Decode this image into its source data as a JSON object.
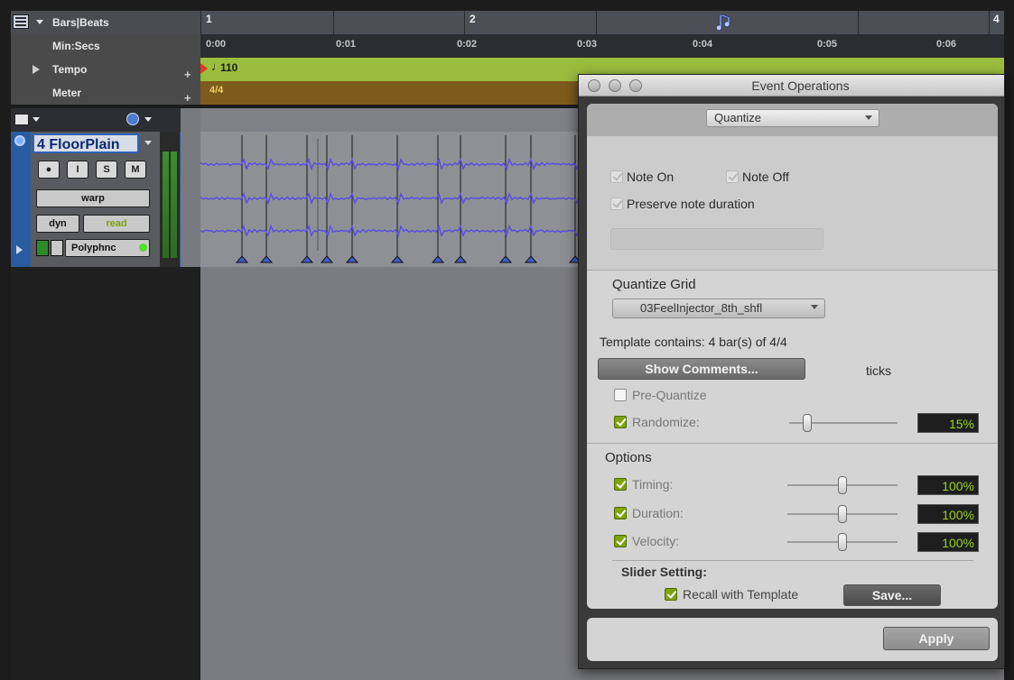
{
  "rulers": {
    "bars_beats": {
      "label": "Bars|Beats",
      "markers": [
        "1",
        "2",
        "4"
      ],
      "icon": "midi-note-icon"
    },
    "min_secs": {
      "label": "Min:Secs",
      "ticks": [
        "0:00",
        "0:01",
        "0:02",
        "0:03",
        "0:04",
        "0:05",
        "0:06"
      ]
    },
    "tempo": {
      "label": "Tempo",
      "value": "110",
      "add_symbol": "+"
    },
    "meter": {
      "label": "Meter",
      "value": "4/4",
      "add_symbol": "+"
    }
  },
  "track": {
    "name": "4 FloorPlain",
    "buttons": {
      "record": "●",
      "input": "I",
      "solo": "S",
      "mute": "M"
    },
    "view_select": "warp",
    "dyn_label": "dyn",
    "dyn_select": "read",
    "voice": "Polyphnc"
  },
  "dialog": {
    "title": "Event Operations",
    "operation": "Quantize",
    "note_options": {
      "note_on": "Note On",
      "note_off": "Note Off",
      "preserve_duration": "Preserve note duration"
    },
    "quantize_grid": {
      "heading": "Quantize Grid",
      "selected": "03FeelInjector_8th_shfl",
      "template_info": "Template contains: 4 bar(s) of 4/4",
      "show_comments": "Show Comments...",
      "ticks_label": "ticks",
      "pre_quantize": "Pre-Quantize",
      "randomize": "Randomize:",
      "randomize_value": "15%"
    },
    "options": {
      "heading": "Options",
      "timing": "Timing:",
      "timing_value": "100%",
      "duration": "Duration:",
      "duration_value": "100%",
      "velocity": "Velocity:",
      "velocity_value": "100%"
    },
    "slider_setting": {
      "heading": "Slider Setting:",
      "recall": "Recall with Template",
      "save": "Save..."
    },
    "apply": "Apply"
  },
  "colors": {
    "tempo_lane": "#9bbd3e",
    "meter_lane": "#7d5b1d",
    "track_blue": "#2a5ba0",
    "check_green": "#7fa30a",
    "percent_green": "#9ad21e",
    "waveform": "#5b4ee0"
  }
}
